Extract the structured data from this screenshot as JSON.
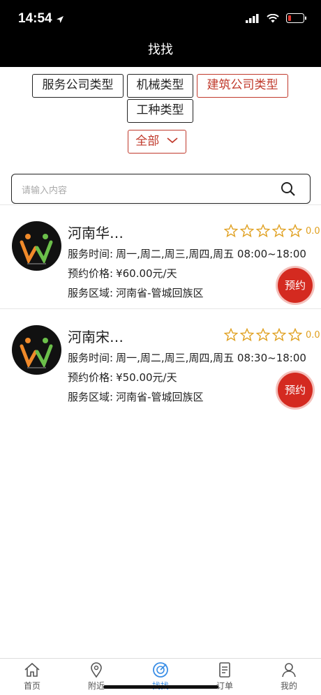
{
  "status_bar": {
    "time": "14:54"
  },
  "nav": {
    "title": "找找"
  },
  "filters": {
    "chips": [
      {
        "label": "服务公司类型",
        "active": false
      },
      {
        "label": "机械类型",
        "active": false
      },
      {
        "label": "建筑公司类型",
        "active": true
      },
      {
        "label": "工种类型",
        "active": false
      }
    ],
    "region_selected": "全部"
  },
  "search": {
    "placeholder": "请输入内容"
  },
  "listings": [
    {
      "name": "河南华…",
      "rating": "0.0",
      "hours_label": "服务时间:",
      "hours_value": "周一,周二,周三,周四,周五 08:00~18:00",
      "price_label": "预约价格:",
      "price_value": "¥60.00元/天",
      "area_label": "服务区域:",
      "area_value": "河南省-管城回族区",
      "book_label": "预约"
    },
    {
      "name": "河南宋…",
      "rating": "0.0",
      "hours_label": "服务时间:",
      "hours_value": "周一,周二,周三,周四,周五 08:30~18:00",
      "price_label": "预约价格:",
      "price_value": "¥50.00元/天",
      "area_label": "服务区域:",
      "area_value": "河南省-管城回族区",
      "book_label": "预约"
    }
  ],
  "tabbar": {
    "items": [
      {
        "label": "首页",
        "icon": "home-icon"
      },
      {
        "label": "附近",
        "icon": "location-pin-icon"
      },
      {
        "label": "找找",
        "icon": "radar-icon",
        "active": true
      },
      {
        "label": "订单",
        "icon": "order-document-icon"
      },
      {
        "label": "我的",
        "icon": "user-icon"
      }
    ]
  },
  "colors": {
    "accent_red": "#c0392b",
    "button_red": "#d42a20",
    "star_gold": "#e0a020",
    "tab_active": "#3a8ee6"
  }
}
